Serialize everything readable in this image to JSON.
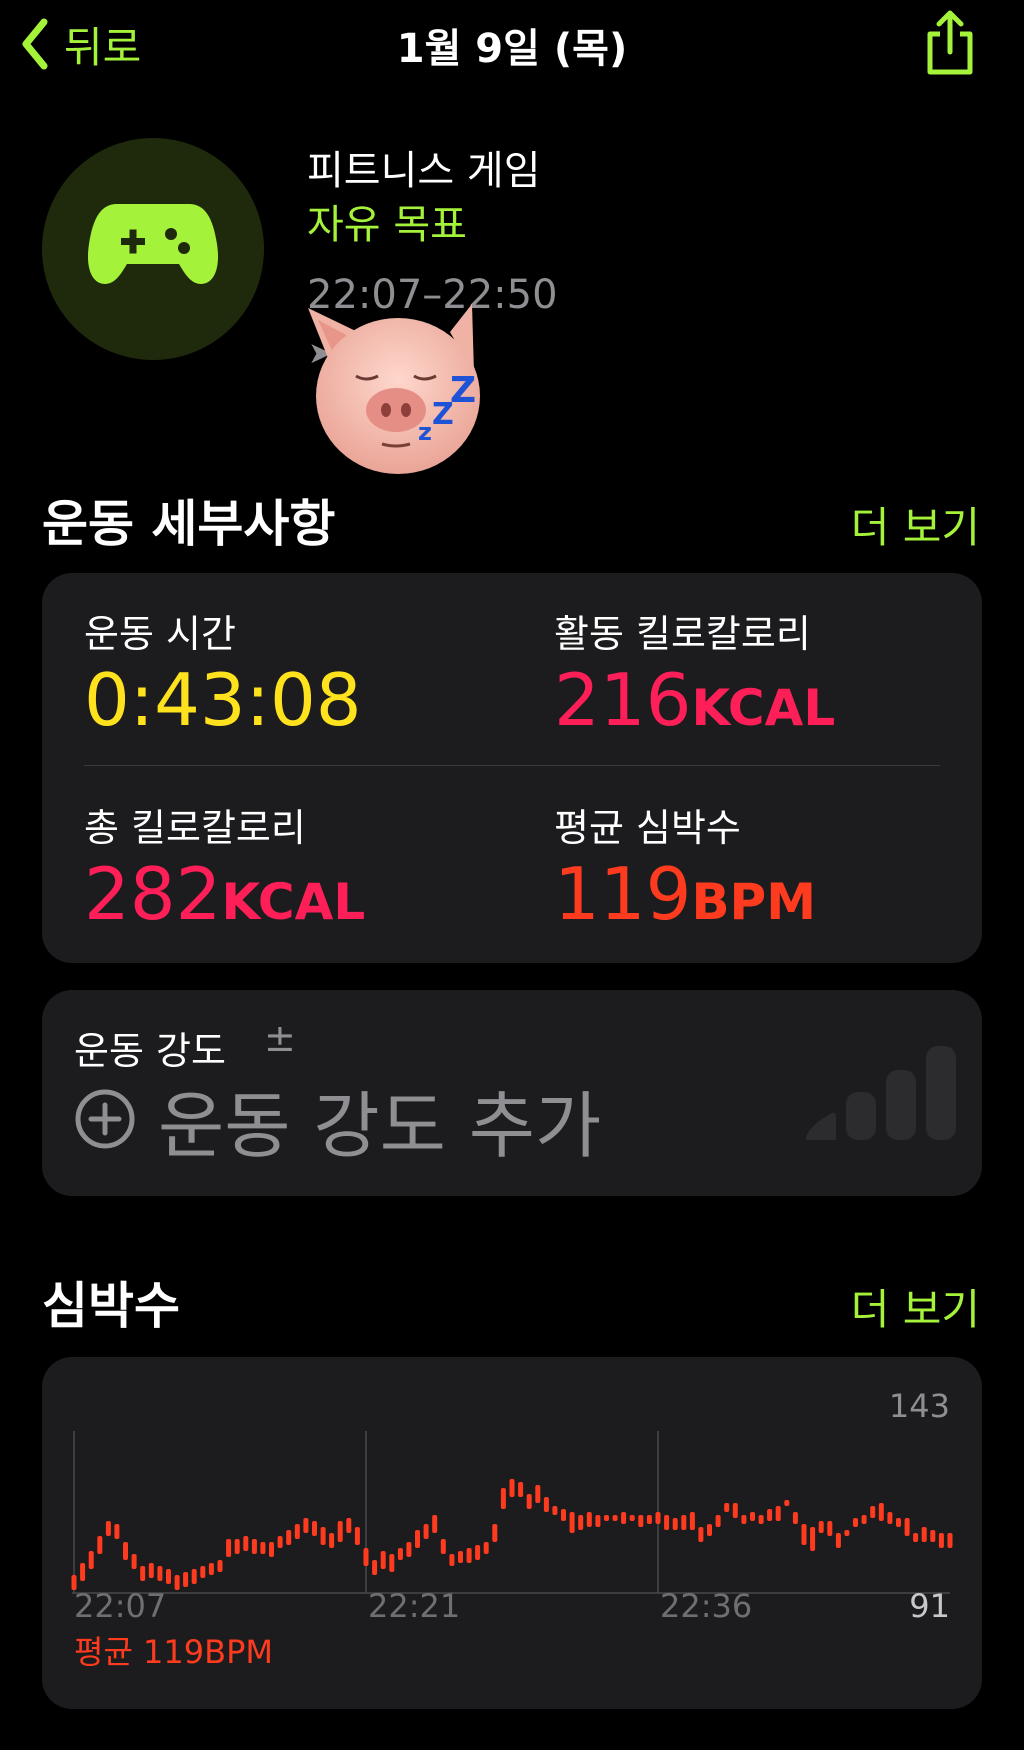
{
  "nav": {
    "back_label": "뒤로",
    "title": "1월 9일 (목)"
  },
  "workout": {
    "title": "피트니스 게임",
    "goal": "자유 목표",
    "time_range": "22:07–22:50",
    "icon": "gamecontroller-icon",
    "accent": "#a4f23a"
  },
  "details": {
    "title": "운동 세부사항",
    "more": "더 보기",
    "metrics": [
      {
        "label": "운동 시간",
        "value": "0:43:08",
        "unit": "",
        "color": "#ffe21e"
      },
      {
        "label": "활동 킬로칼로리",
        "value": "216",
        "unit": "KCAL",
        "color": "#ff1f58"
      },
      {
        "label": "총 킬로칼로리",
        "value": "282",
        "unit": "KCAL",
        "color": "#ff1f58"
      },
      {
        "label": "평균 심박수",
        "value": "119",
        "unit": "BPM",
        "color": "#ff3b1f"
      }
    ]
  },
  "intensity": {
    "label": "운동 강도",
    "pm": "±",
    "add_label": "운동 강도 추가"
  },
  "heart_rate": {
    "title": "심박수",
    "more": "더 보기",
    "avg_label": "평균 119BPM"
  },
  "chart_data": {
    "type": "bar",
    "title": "",
    "y_max_label": "143",
    "y_min_label": "91",
    "ylim": [
      91,
      143
    ],
    "x_ticks": [
      "22:07",
      "22:21",
      "22:36"
    ],
    "color": "#ff3b1f",
    "series": [
      {
        "ranges": [
          [
            92,
            97
          ],
          [
            95,
            101
          ],
          [
            99,
            105
          ],
          [
            104,
            110
          ],
          [
            110,
            115
          ],
          [
            109,
            114
          ],
          [
            102,
            108
          ],
          [
            99,
            104
          ],
          [
            95,
            100
          ],
          [
            96,
            101
          ],
          [
            95,
            100
          ],
          [
            94,
            99
          ],
          [
            92,
            97
          ],
          [
            93,
            98
          ],
          [
            94,
            99
          ],
          [
            96,
            100
          ],
          [
            97,
            101
          ],
          [
            98,
            102
          ],
          [
            103,
            109
          ],
          [
            104,
            109
          ],
          [
            105,
            110
          ],
          [
            104,
            109
          ],
          [
            104,
            108
          ],
          [
            103,
            108
          ],
          [
            106,
            110
          ],
          [
            107,
            112
          ],
          [
            109,
            114
          ],
          [
            111,
            116
          ],
          [
            110,
            115
          ],
          [
            107,
            113
          ],
          [
            106,
            111
          ],
          [
            108,
            115
          ],
          [
            111,
            116
          ],
          [
            107,
            113
          ],
          [
            100,
            106
          ],
          [
            97,
            102
          ],
          [
            99,
            105
          ],
          [
            98,
            104
          ],
          [
            102,
            106
          ],
          [
            103,
            108
          ],
          [
            106,
            112
          ],
          [
            109,
            114
          ],
          [
            111,
            117
          ],
          [
            104,
            109
          ],
          [
            100,
            104
          ],
          [
            101,
            105
          ],
          [
            101,
            106
          ],
          [
            102,
            107
          ],
          [
            104,
            108
          ],
          [
            108,
            114
          ],
          [
            119,
            126
          ],
          [
            123,
            129
          ],
          [
            123,
            128
          ],
          [
            119,
            124
          ],
          [
            121,
            127
          ],
          [
            118,
            123
          ],
          [
            117,
            120
          ],
          [
            115,
            119
          ],
          [
            111,
            118
          ],
          [
            112,
            117
          ],
          [
            113,
            118
          ],
          [
            113,
            117
          ],
          [
            115,
            117
          ],
          [
            115,
            117
          ],
          [
            114,
            118
          ],
          [
            115,
            117
          ],
          [
            113,
            117
          ],
          [
            114,
            117
          ],
          [
            114,
            118
          ],
          [
            112,
            117
          ],
          [
            112,
            116
          ],
          [
            112,
            117
          ],
          [
            112,
            118
          ],
          [
            108,
            113
          ],
          [
            110,
            114
          ],
          [
            113,
            117
          ],
          [
            118,
            121
          ],
          [
            116,
            121
          ],
          [
            114,
            117
          ],
          [
            115,
            118
          ],
          [
            114,
            117
          ],
          [
            115,
            119
          ],
          [
            115,
            120
          ],
          [
            120,
            122
          ],
          [
            114,
            118
          ],
          [
            107,
            114
          ],
          [
            105,
            113
          ],
          [
            111,
            115
          ],
          [
            110,
            115
          ],
          [
            106,
            111
          ],
          [
            110,
            112
          ],
          [
            113,
            116
          ],
          [
            114,
            117
          ],
          [
            116,
            120
          ],
          [
            115,
            121
          ],
          [
            114,
            118
          ],
          [
            113,
            116
          ],
          [
            110,
            116
          ],
          [
            108,
            111
          ],
          [
            108,
            113
          ],
          [
            108,
            112
          ],
          [
            106,
            111
          ],
          [
            106,
            111
          ]
        ]
      }
    ]
  }
}
